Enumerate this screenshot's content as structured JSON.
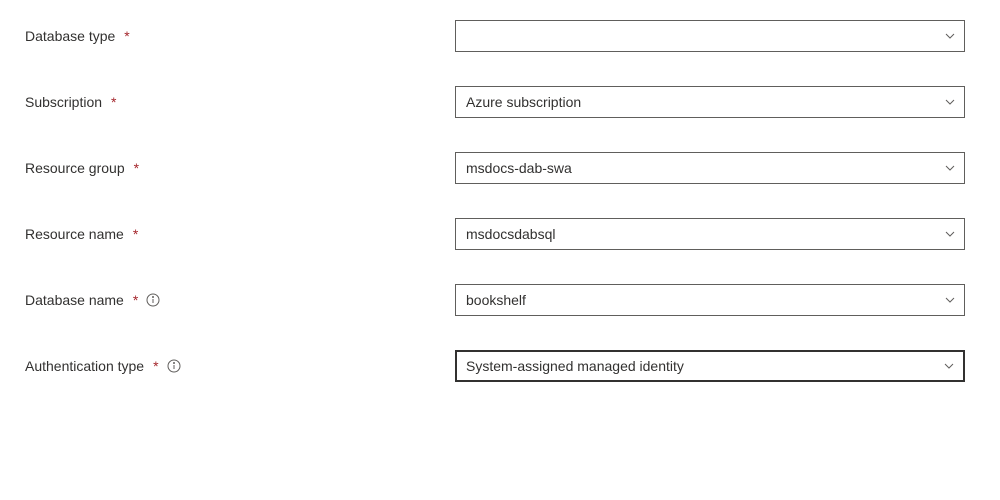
{
  "fields": {
    "database_type": {
      "label": "Database type",
      "value": ""
    },
    "subscription": {
      "label": "Subscription",
      "value": "Azure subscription"
    },
    "resource_group": {
      "label": "Resource group",
      "value": "msdocs-dab-swa"
    },
    "resource_name": {
      "label": "Resource name",
      "value": "msdocsdabsql"
    },
    "database_name": {
      "label": "Database name",
      "value": "bookshelf"
    },
    "authentication_type": {
      "label": "Authentication type",
      "value": "System-assigned managed identity"
    }
  },
  "required_marker": "*"
}
